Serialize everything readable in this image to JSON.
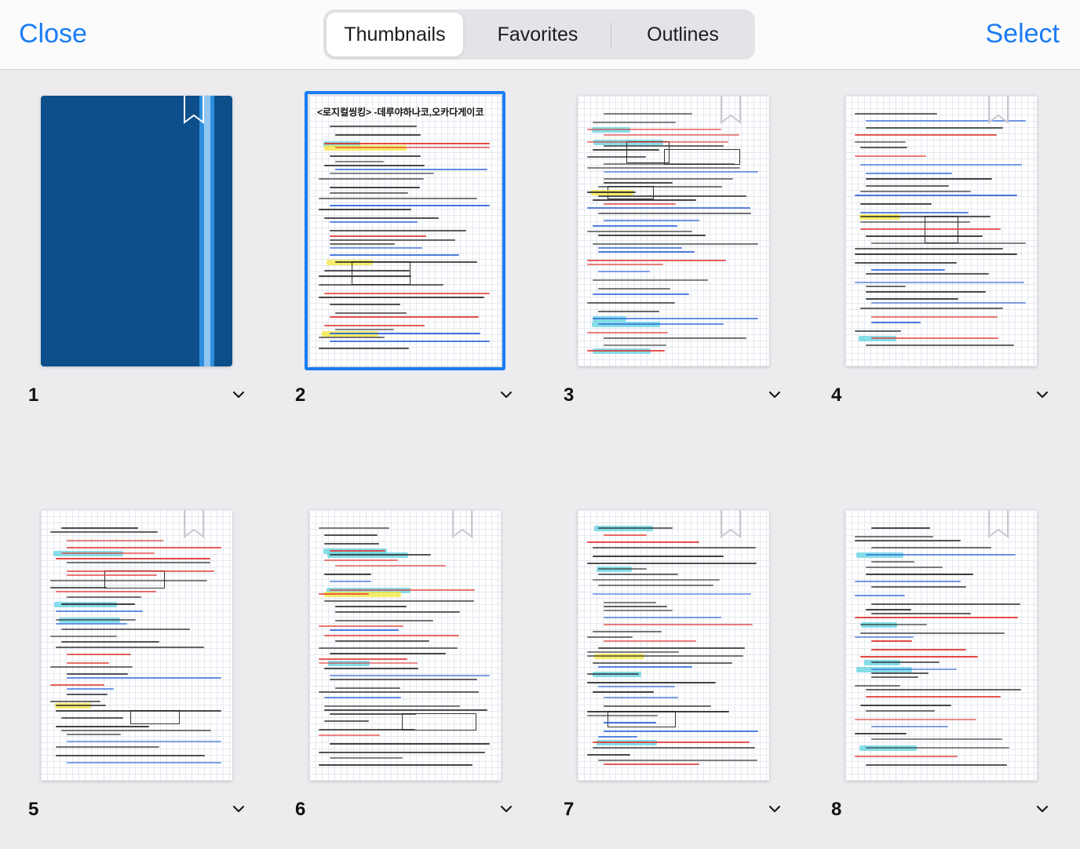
{
  "header": {
    "close_label": "Close",
    "select_label": "Select",
    "tabs": [
      {
        "label": "Thumbnails",
        "active": true
      },
      {
        "label": "Favorites",
        "active": false
      },
      {
        "label": "Outlines",
        "active": false
      }
    ]
  },
  "pages": [
    {
      "number": "1",
      "type": "cover"
    },
    {
      "number": "2",
      "type": "notes",
      "selected": true,
      "title": "<로지컬씽킹> -데루야하나코,오카다게이코"
    },
    {
      "number": "3",
      "type": "notes"
    },
    {
      "number": "4",
      "type": "notes"
    },
    {
      "number": "5",
      "type": "notes"
    },
    {
      "number": "6",
      "type": "notes"
    },
    {
      "number": "7",
      "type": "notes"
    },
    {
      "number": "8",
      "type": "notes"
    }
  ],
  "colors": {
    "accent": "#1a7cf5",
    "cover": "#0d4f8a",
    "ink_black": "#2a2a2a",
    "ink_red": "#e0312b",
    "ink_blue": "#2a62d8",
    "highlight_cyan": "#5fd3e0",
    "highlight_yellow": "#f5e63a"
  },
  "icons": {
    "bookmark": "bookmark-icon",
    "chevron": "chevron-down-icon"
  }
}
